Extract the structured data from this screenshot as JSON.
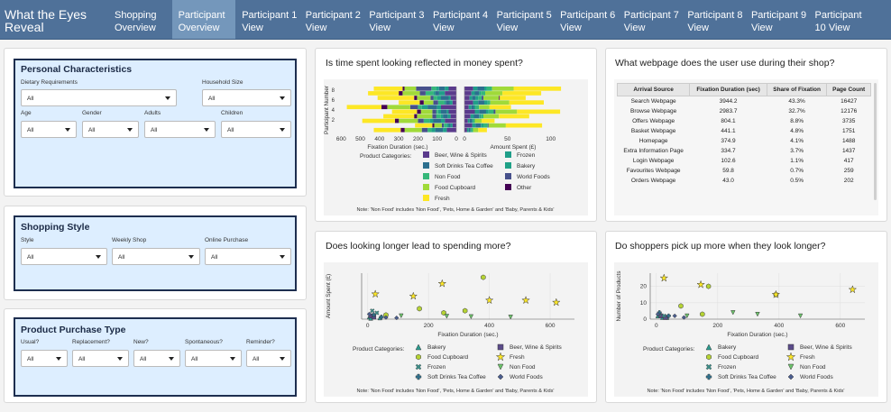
{
  "nav": {
    "title": "What the Eyes Reveal",
    "tabs": [
      "Shopping Overview",
      "Participant Overview",
      "Participant 1 View",
      "Participant 2 View",
      "Participant 3 View",
      "Participant 4 View",
      "Participant 5 View",
      "Participant 6 View",
      "Participant 7 View",
      "Participant 8 View",
      "Participant 9 View",
      "Participant 10 View"
    ],
    "active_tab": "Participant Overview"
  },
  "colors": {
    "nav": "#4f7199",
    "active_tab": "#7497bb",
    "filter_bg": "#ddeeff",
    "filter_border": "#1d2e4f"
  },
  "filters": {
    "personal": {
      "title": "Personal Characteristics",
      "dietary_label": "Dietary Requirements",
      "dietary_value": "All",
      "household_label": "Household Size",
      "household_value": "All",
      "age_label": "Age",
      "age_value": "All",
      "gender_label": "Gender",
      "gender_value": "All",
      "adults_label": "Adults",
      "adults_value": "All",
      "children_label": "Children",
      "children_value": "All"
    },
    "shopping": {
      "title": "Shopping Style",
      "style_label": "Style",
      "style_value": "All",
      "weekly_label": "Weekly Shop",
      "weekly_value": "All",
      "online_label": "Online Purchase",
      "online_value": "All"
    },
    "product": {
      "title": "Product Purchase Type",
      "usual_label": "Usual?",
      "usual_value": "All",
      "replacement_label": "Replacement?",
      "replacement_value": "All",
      "new_label": "New?",
      "new_value": "All",
      "spontaneous_label": "Spontaneous?",
      "spontaneous_value": "All",
      "reminder_label": "Reminder?",
      "reminder_value": "All"
    }
  },
  "panels": {
    "time_money": {
      "title": "Is time spent looking reflected in money spent?"
    },
    "webpage": {
      "title": "What webpage does the user use during their shop?"
    },
    "look_spend": {
      "title": "Does looking longer lead to spending more?"
    },
    "pick_up": {
      "title": "Do shoppers pick up more when they look longer?"
    }
  },
  "webpage_table": {
    "headers": [
      "Arrival Source",
      "Fixation Duration (sec)",
      "Share of Fixation",
      "Page Count"
    ],
    "rows": [
      [
        "Search Webpage",
        "3944.2",
        "43.3%",
        "16427"
      ],
      [
        "Browse Webpage",
        "2983.7",
        "32.7%",
        "12176"
      ],
      [
        "Offers Webpage",
        "804.1",
        "8.8%",
        "3735"
      ],
      [
        "Basket Webpage",
        "441.1",
        "4.8%",
        "1751"
      ],
      [
        "Homepage",
        "374.9",
        "4.1%",
        "1488"
      ],
      [
        "Extra Information Page",
        "334.7",
        "3.7%",
        "1437"
      ],
      [
        "Login Webpage",
        "102.6",
        "1.1%",
        "417"
      ],
      [
        "Favourites Webpage",
        "59.8",
        "0.7%",
        "259"
      ],
      [
        "Orders Webpage",
        "43.0",
        "0.5%",
        "202"
      ]
    ]
  },
  "chart_data": [
    {
      "type": "bar",
      "orientation": "horizontal-stacked",
      "ylabel": "Participant Number",
      "left_xlabel": "Fixation Duration (sec.)",
      "right_xlabel": "Amount Spent (£)",
      "left_ticks": [
        "600",
        "500",
        "400",
        "300",
        "200",
        "100",
        "0"
      ],
      "right_ticks": [
        "0",
        "50",
        "100"
      ],
      "y_ticks": [
        "8",
        "6",
        "4",
        "2"
      ],
      "categories": [
        "Beer, Wine & Spirits",
        "Frozen",
        "Soft Drinks Tea Coffee",
        "Bakery",
        "Non Food",
        "World Foods",
        "Food Cupboard",
        "Other",
        "Fresh"
      ],
      "colors": {
        "Beer, Wine & Spirits": "#5a3a8c",
        "Frozen": "#1f9e89",
        "Soft Drinks Tea Coffee": "#2c6f8e",
        "Bakery": "#1fa187",
        "Non Food": "#35b779",
        "World Foods": "#46508b",
        "Food Cupboard": "#a0da39",
        "Other": "#440154",
        "Fresh": "#fde725"
      },
      "fixation": [
        [
          40,
          20,
          30,
          15,
          25,
          80,
          60,
          10,
          150
        ],
        [
          60,
          30,
          20,
          10,
          40,
          30,
          90,
          20,
          160
        ],
        [
          30,
          10,
          40,
          20,
          20,
          15,
          70,
          15,
          190
        ],
        [
          20,
          15,
          20,
          10,
          30,
          25,
          50,
          20,
          110
        ],
        [
          80,
          20,
          50,
          30,
          20,
          40,
          120,
          30,
          180
        ],
        [
          40,
          10,
          30,
          15,
          10,
          20,
          60,
          20,
          130
        ],
        [
          30,
          15,
          25,
          10,
          25,
          20,
          80,
          15,
          160
        ],
        [
          60,
          20,
          40,
          20,
          30,
          30,
          100,
          20,
          170
        ],
        [
          20,
          10,
          10,
          10,
          15,
          10,
          40,
          10,
          90
        ],
        [
          50,
          20,
          40,
          20,
          20,
          30,
          90,
          20,
          140
        ]
      ],
      "spending": [
        [
          10,
          5,
          8,
          3,
          6,
          0,
          25,
          0,
          55
        ],
        [
          8,
          4,
          5,
          2,
          5,
          0,
          20,
          0,
          45
        ],
        [
          6,
          3,
          4,
          3,
          4,
          2,
          18,
          1,
          30
        ],
        [
          10,
          6,
          7,
          4,
          3,
          0,
          22,
          0,
          40
        ],
        [
          5,
          3,
          3,
          2,
          4,
          0,
          12,
          0,
          25
        ],
        [
          12,
          5,
          8,
          3,
          6,
          2,
          25,
          0,
          50
        ],
        [
          7,
          4,
          6,
          2,
          3,
          0,
          18,
          0,
          35
        ],
        [
          4,
          2,
          3,
          1,
          2,
          0,
          8,
          0,
          15
        ],
        [
          9,
          4,
          6,
          3,
          5,
          1,
          20,
          0,
          42
        ],
        [
          3,
          2,
          2,
          1,
          2,
          0,
          6,
          0,
          10
        ]
      ],
      "legend_title": "Product Categories:",
      "note": "Note: 'Non Food' includes 'Non Food', 'Pets, Home & Garden' and 'Baby, Parents & Kids'"
    },
    {
      "type": "scatter",
      "ylabel": "Amount Spent (£)",
      "xlabel": "Fixation Duration (sec.)",
      "x_ticks": [
        "0",
        "200",
        "400",
        "600"
      ],
      "xlim": [
        -20,
        680
      ],
      "ylim": [
        0,
        110
      ],
      "series": [
        {
          "name": "Bakery",
          "color": "#2a9d8f",
          "shape": "triangle",
          "points": [
            [
              5,
              5
            ],
            [
              10,
              2
            ],
            [
              40,
              3
            ]
          ]
        },
        {
          "name": "Beer, Wine & Spirits",
          "color": "#5b4b8a",
          "shape": "square",
          "points": [
            [
              10,
              8
            ],
            [
              20,
              5
            ]
          ]
        },
        {
          "name": "Food Cupboard",
          "color": "#b5d334",
          "shape": "hexagon",
          "points": [
            [
              170,
              25
            ],
            [
              380,
              100
            ],
            [
              250,
              15
            ],
            [
              320,
              20
            ],
            [
              60,
              10
            ]
          ]
        },
        {
          "name": "Fresh",
          "color": "#fde725",
          "shape": "star",
          "points": [
            [
              25,
              60
            ],
            [
              150,
              55
            ],
            [
              245,
              85
            ],
            [
              400,
              45
            ],
            [
              520,
              45
            ],
            [
              620,
              40
            ]
          ]
        },
        {
          "name": "Frozen",
          "color": "#3a8f89",
          "shape": "x",
          "points": [
            [
              15,
              20
            ],
            [
              30,
              15
            ]
          ]
        },
        {
          "name": "Non Food",
          "color": "#6cc36b",
          "shape": "triangle-down",
          "points": [
            [
              110,
              8
            ],
            [
              260,
              7
            ],
            [
              340,
              6
            ],
            [
              470,
              5
            ]
          ]
        },
        {
          "name": "Soft Drinks Tea Coffee",
          "color": "#2f6f8a",
          "shape": "plus",
          "points": [
            [
              20,
              10
            ],
            [
              45,
              5
            ]
          ]
        },
        {
          "name": "World Foods",
          "color": "#4a5d8e",
          "shape": "diamond",
          "points": [
            [
              5,
              12
            ],
            [
              60,
              4
            ],
            [
              95,
              3
            ]
          ]
        }
      ],
      "legend_title": "Product Categories:",
      "note": "Note: 'Non Food' includes 'Non Food', 'Pets, Home & Garden' and 'Baby, Parents & Kids'"
    },
    {
      "type": "scatter",
      "ylabel": "Number of Products",
      "xlabel": "Fixation Duration (sec.)",
      "x_ticks": [
        "0",
        "200",
        "400",
        "600"
      ],
      "y_ticks": [
        "0",
        "10",
        "20"
      ],
      "xlim": [
        -20,
        680
      ],
      "ylim": [
        0,
        28
      ],
      "series": [
        {
          "name": "Bakery",
          "color": "#2a9d8f",
          "shape": "triangle",
          "points": [
            [
              5,
              2
            ],
            [
              20,
              1
            ],
            [
              35,
              1
            ]
          ]
        },
        {
          "name": "Beer, Wine & Spirits",
          "color": "#5b4b8a",
          "shape": "square",
          "points": [
            [
              15,
              2
            ],
            [
              30,
              1
            ]
          ]
        },
        {
          "name": "Food Cupboard",
          "color": "#b5d334",
          "shape": "hexagon",
          "points": [
            [
              170,
              20
            ],
            [
              390,
              15
            ],
            [
              80,
              8
            ],
            [
              150,
              3
            ]
          ]
        },
        {
          "name": "Fresh",
          "color": "#fde725",
          "shape": "star",
          "points": [
            [
              25,
              25
            ],
            [
              145,
              21
            ],
            [
              390,
              15
            ],
            [
              640,
              18
            ]
          ]
        },
        {
          "name": "Frozen",
          "color": "#3a8f89",
          "shape": "x",
          "points": [
            [
              10,
              3
            ],
            [
              25,
              2
            ]
          ]
        },
        {
          "name": "Non Food",
          "color": "#6cc36b",
          "shape": "triangle-down",
          "points": [
            [
              100,
              2
            ],
            [
              250,
              4
            ],
            [
              330,
              3
            ],
            [
              470,
              2
            ]
          ]
        },
        {
          "name": "Soft Drinks Tea Coffee",
          "color": "#2f6f8a",
          "shape": "plus",
          "points": [
            [
              10,
              4
            ],
            [
              40,
              2
            ]
          ]
        },
        {
          "name": "World Foods",
          "color": "#4a5d8e",
          "shape": "diamond",
          "points": [
            [
              5,
              3
            ],
            [
              60,
              2
            ],
            [
              90,
              1
            ]
          ]
        }
      ],
      "legend_title": "Product Categories:",
      "note": "Note: 'Non Food' includes 'Non Food', 'Pets, Home & Garden' and 'Baby, Parents & Kids'"
    }
  ]
}
